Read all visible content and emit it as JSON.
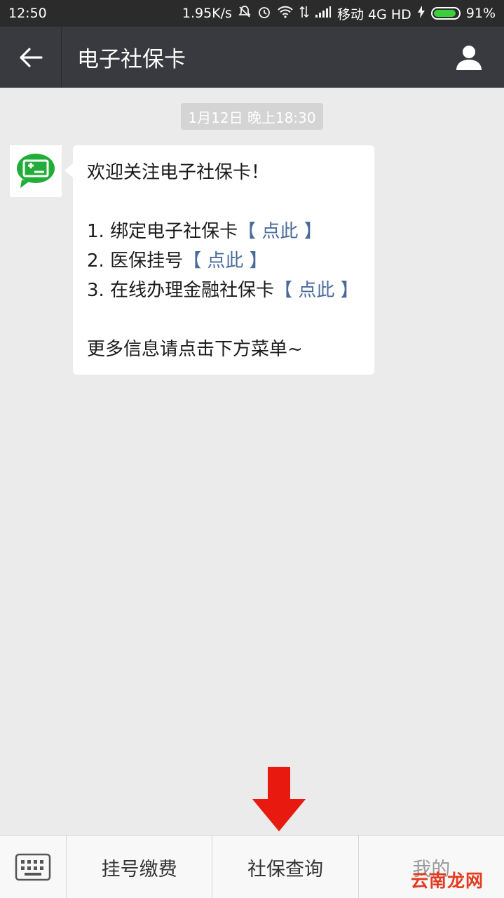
{
  "status_bar": {
    "time": "12:50",
    "speed": "1.95K/s",
    "carrier": "移动 4G HD",
    "battery_text": "91%",
    "battery_level": 0.91,
    "icons": [
      "mute-bell-icon",
      "alarm-icon",
      "wifi-icon",
      "data-transfer-icon",
      "signal-icon",
      "charging-icon",
      "battery-icon"
    ]
  },
  "navbar": {
    "title": "电子社保卡",
    "back_icon": "back-arrow-icon",
    "profile_icon": "person-icon"
  },
  "chat": {
    "timestamp": "1月12日 晚上18:30",
    "avatar_icon": "social-security-card-icon",
    "message": {
      "greeting": "欢迎关注电子社保卡！",
      "items": [
        {
          "text": "1. 绑定电子社保卡",
          "link": "【 点此 】"
        },
        {
          "text": "2. 医保挂号",
          "link": "【 点此 】"
        },
        {
          "text": "3. 在线办理金融社保卡",
          "link": "【 点此 】"
        }
      ],
      "footer": "更多信息请点击下方菜单~"
    },
    "accent_color": "#e8190f"
  },
  "menu": {
    "keyboard_icon": "keyboard-icon",
    "items": [
      "挂号缴费",
      "社保查询",
      "我的"
    ]
  },
  "watermark": "云南龙网"
}
